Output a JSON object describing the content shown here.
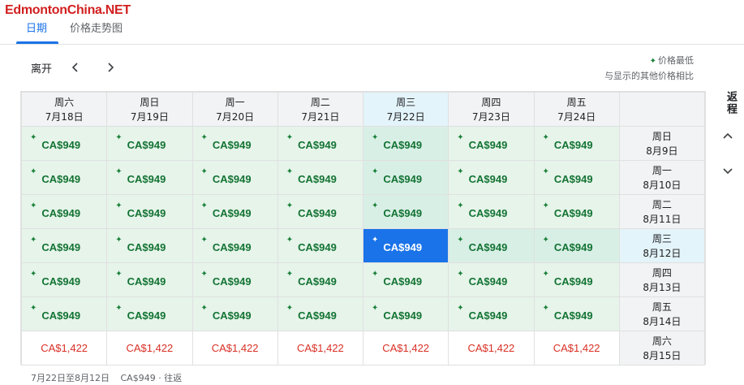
{
  "logo": "EdmontonChina.NET",
  "tabs": [
    {
      "label": "日期",
      "active": true
    },
    {
      "label": "价格走势图",
      "active": false
    }
  ],
  "toolbar": {
    "depart_label": "离开",
    "prev_icon": "chevron-left-icon",
    "next_icon": "chevron-right-icon"
  },
  "legend": {
    "lowest": "价格最低",
    "note": "与显示的其他价格相比"
  },
  "return_label": "返程",
  "columns": [
    {
      "weekday": "周六",
      "date": "7月18日"
    },
    {
      "weekday": "周日",
      "date": "7月19日"
    },
    {
      "weekday": "周一",
      "date": "7月20日"
    },
    {
      "weekday": "周二",
      "date": "7月21日"
    },
    {
      "weekday": "周三",
      "date": "7月22日"
    },
    {
      "weekday": "周四",
      "date": "7月23日"
    },
    {
      "weekday": "周五",
      "date": "7月24日"
    }
  ],
  "rows": [
    {
      "weekday": "周日",
      "date": "8月9日",
      "prices": [
        "CA$949",
        "CA$949",
        "CA$949",
        "CA$949",
        "CA$949",
        "CA$949",
        "CA$949"
      ]
    },
    {
      "weekday": "周一",
      "date": "8月10日",
      "prices": [
        "CA$949",
        "CA$949",
        "CA$949",
        "CA$949",
        "CA$949",
        "CA$949",
        "CA$949"
      ]
    },
    {
      "weekday": "周二",
      "date": "8月11日",
      "prices": [
        "CA$949",
        "CA$949",
        "CA$949",
        "CA$949",
        "CA$949",
        "CA$949",
        "CA$949"
      ]
    },
    {
      "weekday": "周三",
      "date": "8月12日",
      "prices": [
        "CA$949",
        "CA$949",
        "CA$949",
        "CA$949",
        "CA$949",
        "CA$949",
        "CA$949"
      ]
    },
    {
      "weekday": "周四",
      "date": "8月13日",
      "prices": [
        "CA$949",
        "CA$949",
        "CA$949",
        "CA$949",
        "CA$949",
        "CA$949",
        "CA$949"
      ]
    },
    {
      "weekday": "周五",
      "date": "8月14日",
      "prices": [
        "CA$949",
        "CA$949",
        "CA$949",
        "CA$949",
        "CA$949",
        "CA$949",
        "CA$949"
      ]
    },
    {
      "weekday": "周六",
      "date": "8月15日",
      "prices": [
        "CA$1,422",
        "CA$1,422",
        "CA$1,422",
        "CA$1,422",
        "CA$1,422",
        "CA$1,422",
        "CA$1,422"
      ]
    }
  ],
  "selected": {
    "row": 3,
    "col": 4
  },
  "footer": {
    "range": "7月22日至8月12日",
    "summary": "CA$949 · 往返"
  },
  "colors": {
    "accent": "#1a73e8",
    "low_price_text": "#137333",
    "low_price_bg": "#e6f4ea",
    "high_price_text": "#d93025",
    "logo": "#d21f1f"
  }
}
